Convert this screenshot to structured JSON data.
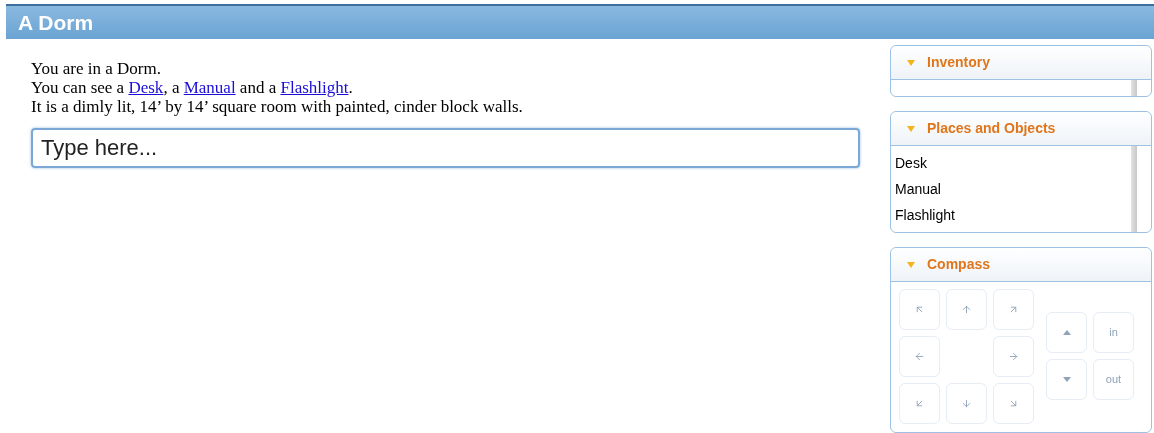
{
  "window": {
    "title": "A Dorm"
  },
  "description": [
    {
      "segments": [
        {
          "kind": "text",
          "text": "You are in a Dorm."
        }
      ]
    },
    {
      "segments": [
        {
          "kind": "text",
          "text": "You can see a "
        },
        {
          "kind": "link",
          "text": "Desk"
        },
        {
          "kind": "text",
          "text": ", a "
        },
        {
          "kind": "link",
          "text": "Manual"
        },
        {
          "kind": "text",
          "text": " and a "
        },
        {
          "kind": "link",
          "text": "Flashlight"
        },
        {
          "kind": "text",
          "text": "."
        }
      ]
    },
    {
      "segments": [
        {
          "kind": "text",
          "text": "It is a dimly lit, 14’ by 14’ square room with painted, cinder block walls."
        }
      ]
    }
  ],
  "command_input": {
    "placeholder": "Type here..."
  },
  "sidebar": [
    {
      "kind": "list",
      "title": "Inventory",
      "expanded": true
    },
    {
      "kind": "list",
      "title": "Places and Objects",
      "expanded": true,
      "items": [
        "Desk",
        "Manual",
        "Flashlight"
      ]
    },
    {
      "kind": "compass",
      "title": "Compass",
      "expanded": true,
      "disabled": true,
      "in_label": "in",
      "out_label": "out"
    }
  ]
}
